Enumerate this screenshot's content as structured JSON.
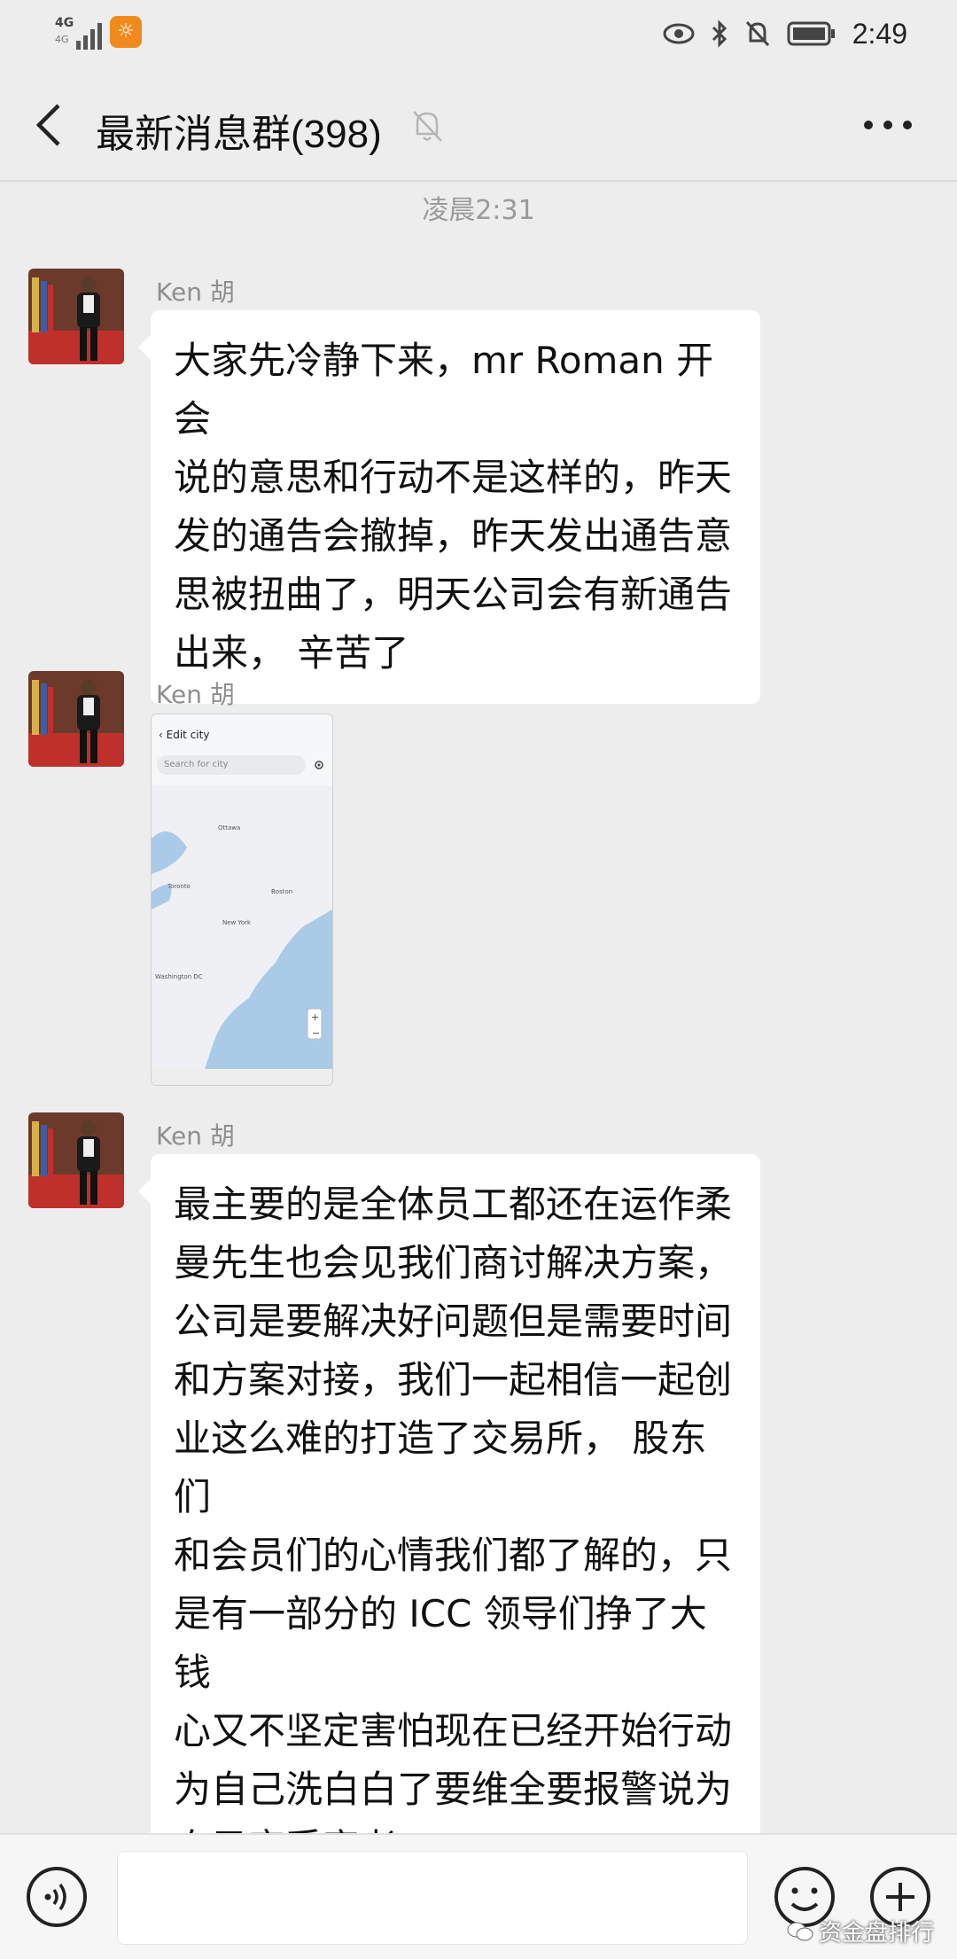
{
  "status_bar": {
    "network": "4G",
    "network_sub": "4G",
    "time": "2:49"
  },
  "header": {
    "title": "最新消息群(398)"
  },
  "timestamp": "凌晨2:31",
  "messages": [
    {
      "sender": "Ken 胡",
      "lines": [
        "大家先冷静下来，mr Roman 开会",
        "说的意思和行动不是这样的，昨天",
        "发的通告会撤掉，昨天发出通告意",
        "思被扭曲了，明天公司会有新通告",
        "出来，  辛苦了"
      ]
    },
    {
      "sender": "Ken 胡",
      "image": {
        "header": "Edit city",
        "search_placeholder": "Search for city",
        "cities": [
          "Ottawa",
          "Toronto",
          "Boston",
          "New York",
          "Washington DC"
        ]
      }
    },
    {
      "sender": "Ken 胡",
      "lines": [
        "最主要的是全体员工都还在运作柔",
        "曼先生也会见我们商讨解决方案，",
        "公司是要解决好问题但是需要时间",
        "和方案对接，我们一起相信一起创",
        "业这么难的打造了交易所，  股东们",
        "和会员们的心情我们都了解的，只",
        "是有一部分的 ICC 领导们挣了大钱",
        "心又不坚定害怕现在已经开始行动",
        "为自己洗白白了要维全要报警说为",
        "自己变受害者。"
      ]
    }
  ],
  "watermark": "资金盘排行"
}
